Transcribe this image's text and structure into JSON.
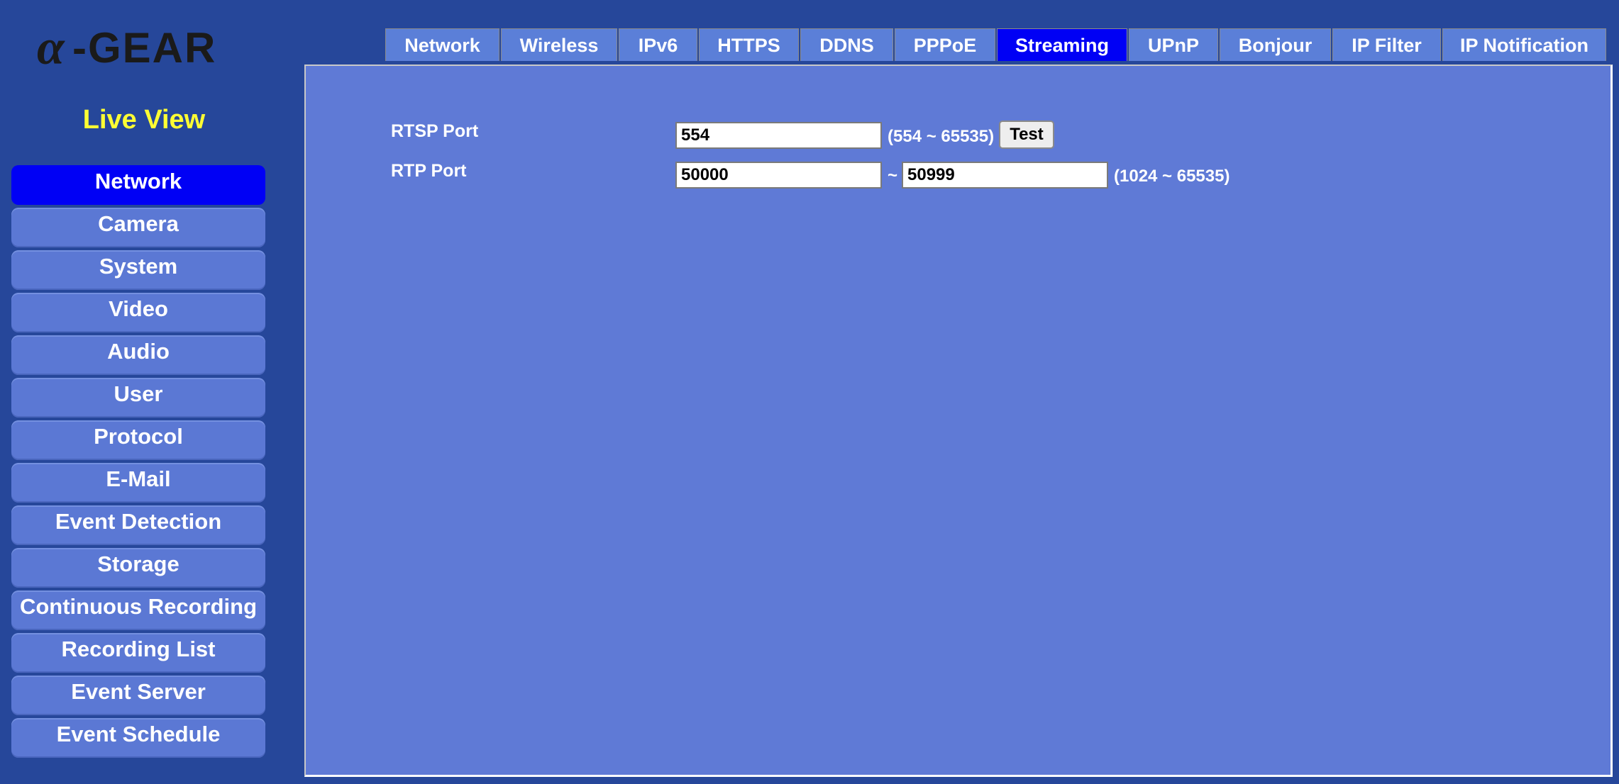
{
  "brand": {
    "logo_text": "α-GEAR"
  },
  "live_view": "Live View",
  "sidebar": {
    "items": [
      {
        "label": "Network",
        "active": true
      },
      {
        "label": "Camera"
      },
      {
        "label": "System"
      },
      {
        "label": "Video"
      },
      {
        "label": "Audio"
      },
      {
        "label": "User"
      },
      {
        "label": "Protocol"
      },
      {
        "label": "E-Mail"
      },
      {
        "label": "Event Detection"
      },
      {
        "label": "Storage"
      },
      {
        "label": "Continuous Recording"
      },
      {
        "label": "Recording List"
      },
      {
        "label": "Event Server"
      },
      {
        "label": "Event Schedule"
      }
    ]
  },
  "tabs": [
    {
      "label": "Network"
    },
    {
      "label": "Wireless"
    },
    {
      "label": "IPv6"
    },
    {
      "label": "HTTPS"
    },
    {
      "label": "DDNS"
    },
    {
      "label": "PPPoE"
    },
    {
      "label": "Streaming",
      "active": true
    },
    {
      "label": "UPnP"
    },
    {
      "label": "Bonjour"
    },
    {
      "label": "IP Filter"
    },
    {
      "label": "IP Notification"
    }
  ],
  "form": {
    "rtsp": {
      "label": "RTSP Port",
      "value": "554",
      "range_hint": "(554 ~ 65535)",
      "test_label": "Test"
    },
    "rtp": {
      "label": "RTP Port",
      "start_value": "50000",
      "separator": "~",
      "end_value": "50999",
      "range_hint": "(1024 ~ 65535)"
    }
  },
  "colors": {
    "page_background": "#26479a",
    "panel_background": "#5f7ad6",
    "menu_item": "#5b78d4",
    "active_blue": "#0000f5",
    "live_view_yellow": "#ffff33"
  }
}
